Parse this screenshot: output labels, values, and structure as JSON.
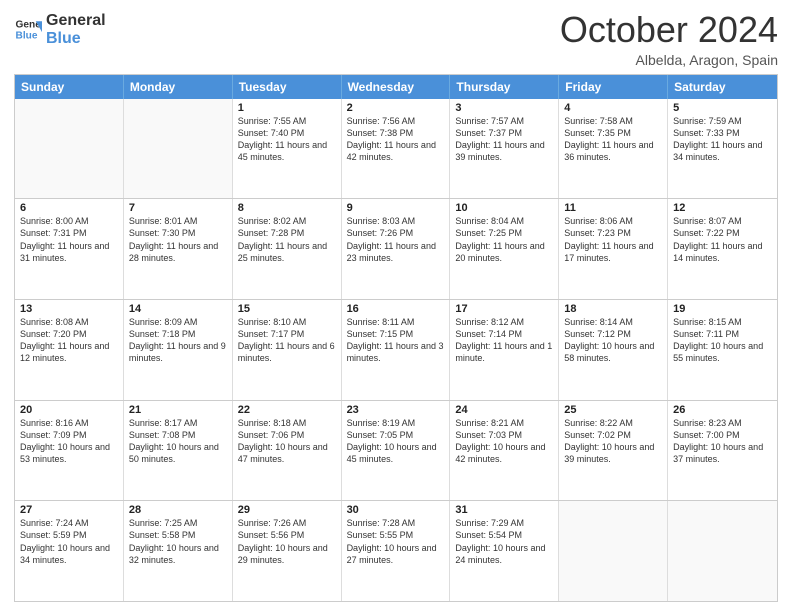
{
  "logo": {
    "line1": "General",
    "line2": "Blue"
  },
  "title": "October 2024",
  "location": "Albelda, Aragon, Spain",
  "days": [
    "Sunday",
    "Monday",
    "Tuesday",
    "Wednesday",
    "Thursday",
    "Friday",
    "Saturday"
  ],
  "weeks": [
    [
      {
        "day": "",
        "sunrise": "",
        "sunset": "",
        "daylight": "",
        "empty": true
      },
      {
        "day": "",
        "sunrise": "",
        "sunset": "",
        "daylight": "",
        "empty": true
      },
      {
        "day": "1",
        "sunrise": "Sunrise: 7:55 AM",
        "sunset": "Sunset: 7:40 PM",
        "daylight": "Daylight: 11 hours and 45 minutes."
      },
      {
        "day": "2",
        "sunrise": "Sunrise: 7:56 AM",
        "sunset": "Sunset: 7:38 PM",
        "daylight": "Daylight: 11 hours and 42 minutes."
      },
      {
        "day": "3",
        "sunrise": "Sunrise: 7:57 AM",
        "sunset": "Sunset: 7:37 PM",
        "daylight": "Daylight: 11 hours and 39 minutes."
      },
      {
        "day": "4",
        "sunrise": "Sunrise: 7:58 AM",
        "sunset": "Sunset: 7:35 PM",
        "daylight": "Daylight: 11 hours and 36 minutes."
      },
      {
        "day": "5",
        "sunrise": "Sunrise: 7:59 AM",
        "sunset": "Sunset: 7:33 PM",
        "daylight": "Daylight: 11 hours and 34 minutes."
      }
    ],
    [
      {
        "day": "6",
        "sunrise": "Sunrise: 8:00 AM",
        "sunset": "Sunset: 7:31 PM",
        "daylight": "Daylight: 11 hours and 31 minutes."
      },
      {
        "day": "7",
        "sunrise": "Sunrise: 8:01 AM",
        "sunset": "Sunset: 7:30 PM",
        "daylight": "Daylight: 11 hours and 28 minutes."
      },
      {
        "day": "8",
        "sunrise": "Sunrise: 8:02 AM",
        "sunset": "Sunset: 7:28 PM",
        "daylight": "Daylight: 11 hours and 25 minutes."
      },
      {
        "day": "9",
        "sunrise": "Sunrise: 8:03 AM",
        "sunset": "Sunset: 7:26 PM",
        "daylight": "Daylight: 11 hours and 23 minutes."
      },
      {
        "day": "10",
        "sunrise": "Sunrise: 8:04 AM",
        "sunset": "Sunset: 7:25 PM",
        "daylight": "Daylight: 11 hours and 20 minutes."
      },
      {
        "day": "11",
        "sunrise": "Sunrise: 8:06 AM",
        "sunset": "Sunset: 7:23 PM",
        "daylight": "Daylight: 11 hours and 17 minutes."
      },
      {
        "day": "12",
        "sunrise": "Sunrise: 8:07 AM",
        "sunset": "Sunset: 7:22 PM",
        "daylight": "Daylight: 11 hours and 14 minutes."
      }
    ],
    [
      {
        "day": "13",
        "sunrise": "Sunrise: 8:08 AM",
        "sunset": "Sunset: 7:20 PM",
        "daylight": "Daylight: 11 hours and 12 minutes."
      },
      {
        "day": "14",
        "sunrise": "Sunrise: 8:09 AM",
        "sunset": "Sunset: 7:18 PM",
        "daylight": "Daylight: 11 hours and 9 minutes."
      },
      {
        "day": "15",
        "sunrise": "Sunrise: 8:10 AM",
        "sunset": "Sunset: 7:17 PM",
        "daylight": "Daylight: 11 hours and 6 minutes."
      },
      {
        "day": "16",
        "sunrise": "Sunrise: 8:11 AM",
        "sunset": "Sunset: 7:15 PM",
        "daylight": "Daylight: 11 hours and 3 minutes."
      },
      {
        "day": "17",
        "sunrise": "Sunrise: 8:12 AM",
        "sunset": "Sunset: 7:14 PM",
        "daylight": "Daylight: 11 hours and 1 minute."
      },
      {
        "day": "18",
        "sunrise": "Sunrise: 8:14 AM",
        "sunset": "Sunset: 7:12 PM",
        "daylight": "Daylight: 10 hours and 58 minutes."
      },
      {
        "day": "19",
        "sunrise": "Sunrise: 8:15 AM",
        "sunset": "Sunset: 7:11 PM",
        "daylight": "Daylight: 10 hours and 55 minutes."
      }
    ],
    [
      {
        "day": "20",
        "sunrise": "Sunrise: 8:16 AM",
        "sunset": "Sunset: 7:09 PM",
        "daylight": "Daylight: 10 hours and 53 minutes."
      },
      {
        "day": "21",
        "sunrise": "Sunrise: 8:17 AM",
        "sunset": "Sunset: 7:08 PM",
        "daylight": "Daylight: 10 hours and 50 minutes."
      },
      {
        "day": "22",
        "sunrise": "Sunrise: 8:18 AM",
        "sunset": "Sunset: 7:06 PM",
        "daylight": "Daylight: 10 hours and 47 minutes."
      },
      {
        "day": "23",
        "sunrise": "Sunrise: 8:19 AM",
        "sunset": "Sunset: 7:05 PM",
        "daylight": "Daylight: 10 hours and 45 minutes."
      },
      {
        "day": "24",
        "sunrise": "Sunrise: 8:21 AM",
        "sunset": "Sunset: 7:03 PM",
        "daylight": "Daylight: 10 hours and 42 minutes."
      },
      {
        "day": "25",
        "sunrise": "Sunrise: 8:22 AM",
        "sunset": "Sunset: 7:02 PM",
        "daylight": "Daylight: 10 hours and 39 minutes."
      },
      {
        "day": "26",
        "sunrise": "Sunrise: 8:23 AM",
        "sunset": "Sunset: 7:00 PM",
        "daylight": "Daylight: 10 hours and 37 minutes."
      }
    ],
    [
      {
        "day": "27",
        "sunrise": "Sunrise: 7:24 AM",
        "sunset": "Sunset: 5:59 PM",
        "daylight": "Daylight: 10 hours and 34 minutes."
      },
      {
        "day": "28",
        "sunrise": "Sunrise: 7:25 AM",
        "sunset": "Sunset: 5:58 PM",
        "daylight": "Daylight: 10 hours and 32 minutes."
      },
      {
        "day": "29",
        "sunrise": "Sunrise: 7:26 AM",
        "sunset": "Sunset: 5:56 PM",
        "daylight": "Daylight: 10 hours and 29 minutes."
      },
      {
        "day": "30",
        "sunrise": "Sunrise: 7:28 AM",
        "sunset": "Sunset: 5:55 PM",
        "daylight": "Daylight: 10 hours and 27 minutes."
      },
      {
        "day": "31",
        "sunrise": "Sunrise: 7:29 AM",
        "sunset": "Sunset: 5:54 PM",
        "daylight": "Daylight: 10 hours and 24 minutes."
      },
      {
        "day": "",
        "sunrise": "",
        "sunset": "",
        "daylight": "",
        "empty": true
      },
      {
        "day": "",
        "sunrise": "",
        "sunset": "",
        "daylight": "",
        "empty": true
      }
    ]
  ]
}
